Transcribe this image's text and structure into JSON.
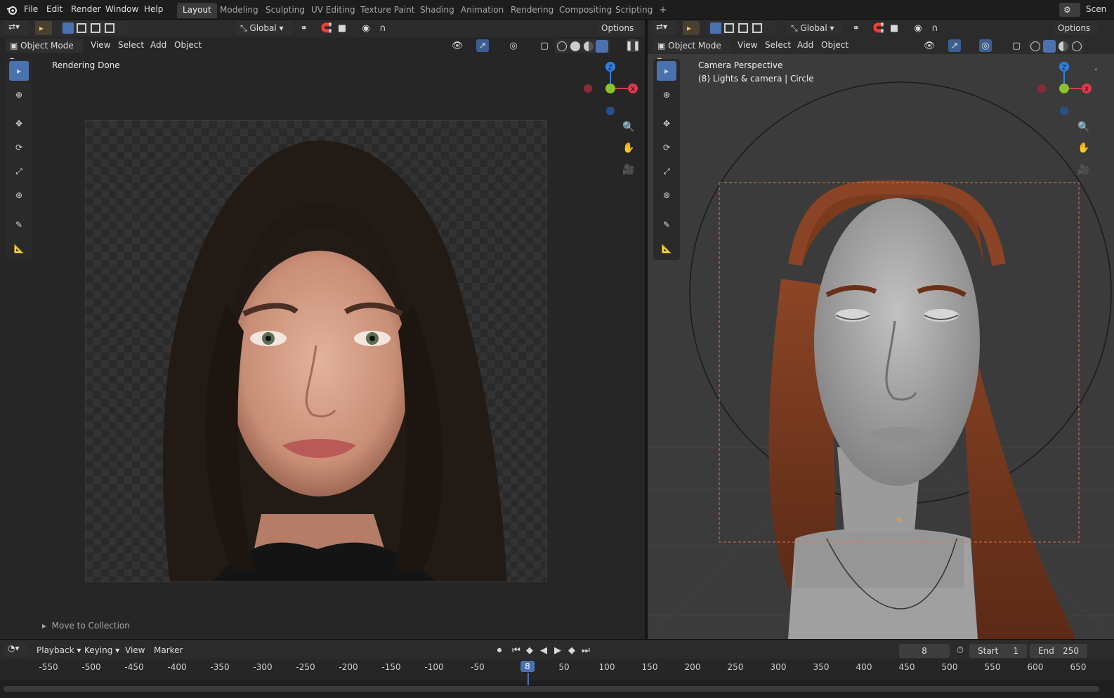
{
  "menus": [
    "File",
    "Edit",
    "Render",
    "Window",
    "Help"
  ],
  "workspaces": [
    "Layout",
    "Modeling",
    "Sculpting",
    "UV Editing",
    "Texture Paint",
    "Shading",
    "Animation",
    "Rendering",
    "Compositing",
    "Scripting"
  ],
  "scene_label": "Scen",
  "left_view": {
    "orientation": "Global",
    "options": "Options",
    "mode": "Object Mode",
    "menu": [
      "View",
      "Select",
      "Add",
      "Object"
    ],
    "overlay_text": "Rendering Done",
    "operator_panel": "Move to Collection"
  },
  "right_view": {
    "orientation": "Global",
    "options": "Options",
    "mode": "Object Mode",
    "menu": [
      "View",
      "Select",
      "Add",
      "Object"
    ],
    "overlay_line1": "Camera Perspective",
    "overlay_line2": "(8) Lights & camera | Circle"
  },
  "gizmo": {
    "z": "Z",
    "x": "X",
    "colors": {
      "x": "#e0384c",
      "y": "#8ac42a",
      "z": "#2f7fe0"
    }
  },
  "timeline": {
    "menu": [
      "Playback",
      "Keying",
      "View",
      "Marker"
    ],
    "current_frame": "8",
    "start_label": "Start",
    "start": "1",
    "end_label": "End",
    "end": "250",
    "ticks": [
      "-550",
      "-500",
      "-450",
      "-400",
      "-350",
      "-300",
      "-250",
      "-200",
      "-150",
      "-100",
      "-50",
      "8",
      "50",
      "100",
      "150",
      "200",
      "250",
      "300",
      "350",
      "400",
      "450",
      "500",
      "550",
      "600",
      "650"
    ]
  },
  "colors": {
    "accent": "#4a72b0",
    "hair_left": "#241c17",
    "hair_right": "#7a3a1e",
    "skin": "#d9a590"
  }
}
